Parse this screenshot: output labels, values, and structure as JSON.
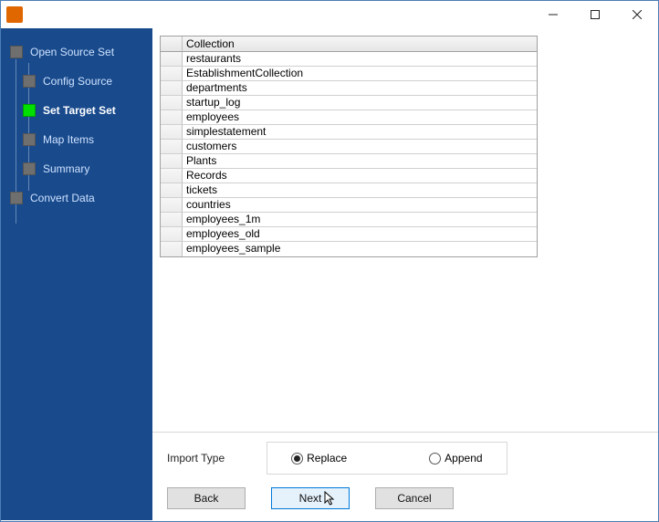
{
  "sidebar": {
    "items": [
      {
        "label": "Open Source Set",
        "level": 1,
        "active": false
      },
      {
        "label": "Config Source",
        "level": 2,
        "active": false
      },
      {
        "label": "Set Target Set",
        "level": 2,
        "active": true
      },
      {
        "label": "Map Items",
        "level": 2,
        "active": false
      },
      {
        "label": "Summary",
        "level": 2,
        "active": false
      },
      {
        "label": "Convert Data",
        "level": 1,
        "active": false
      }
    ]
  },
  "grid": {
    "header": "Collection",
    "rows": [
      "restaurants",
      "EstablishmentCollection",
      "departments",
      "startup_log",
      "employees",
      "simplestatement",
      "customers",
      "Plants",
      "Records",
      "tickets",
      "countries",
      "employees_1m",
      "employees_old",
      "employees_sample"
    ]
  },
  "import": {
    "label": "Import Type",
    "options": {
      "replace": "Replace",
      "append": "Append"
    },
    "selected": "replace"
  },
  "buttons": {
    "back": "Back",
    "next": "Next",
    "cancel": "Cancel"
  }
}
